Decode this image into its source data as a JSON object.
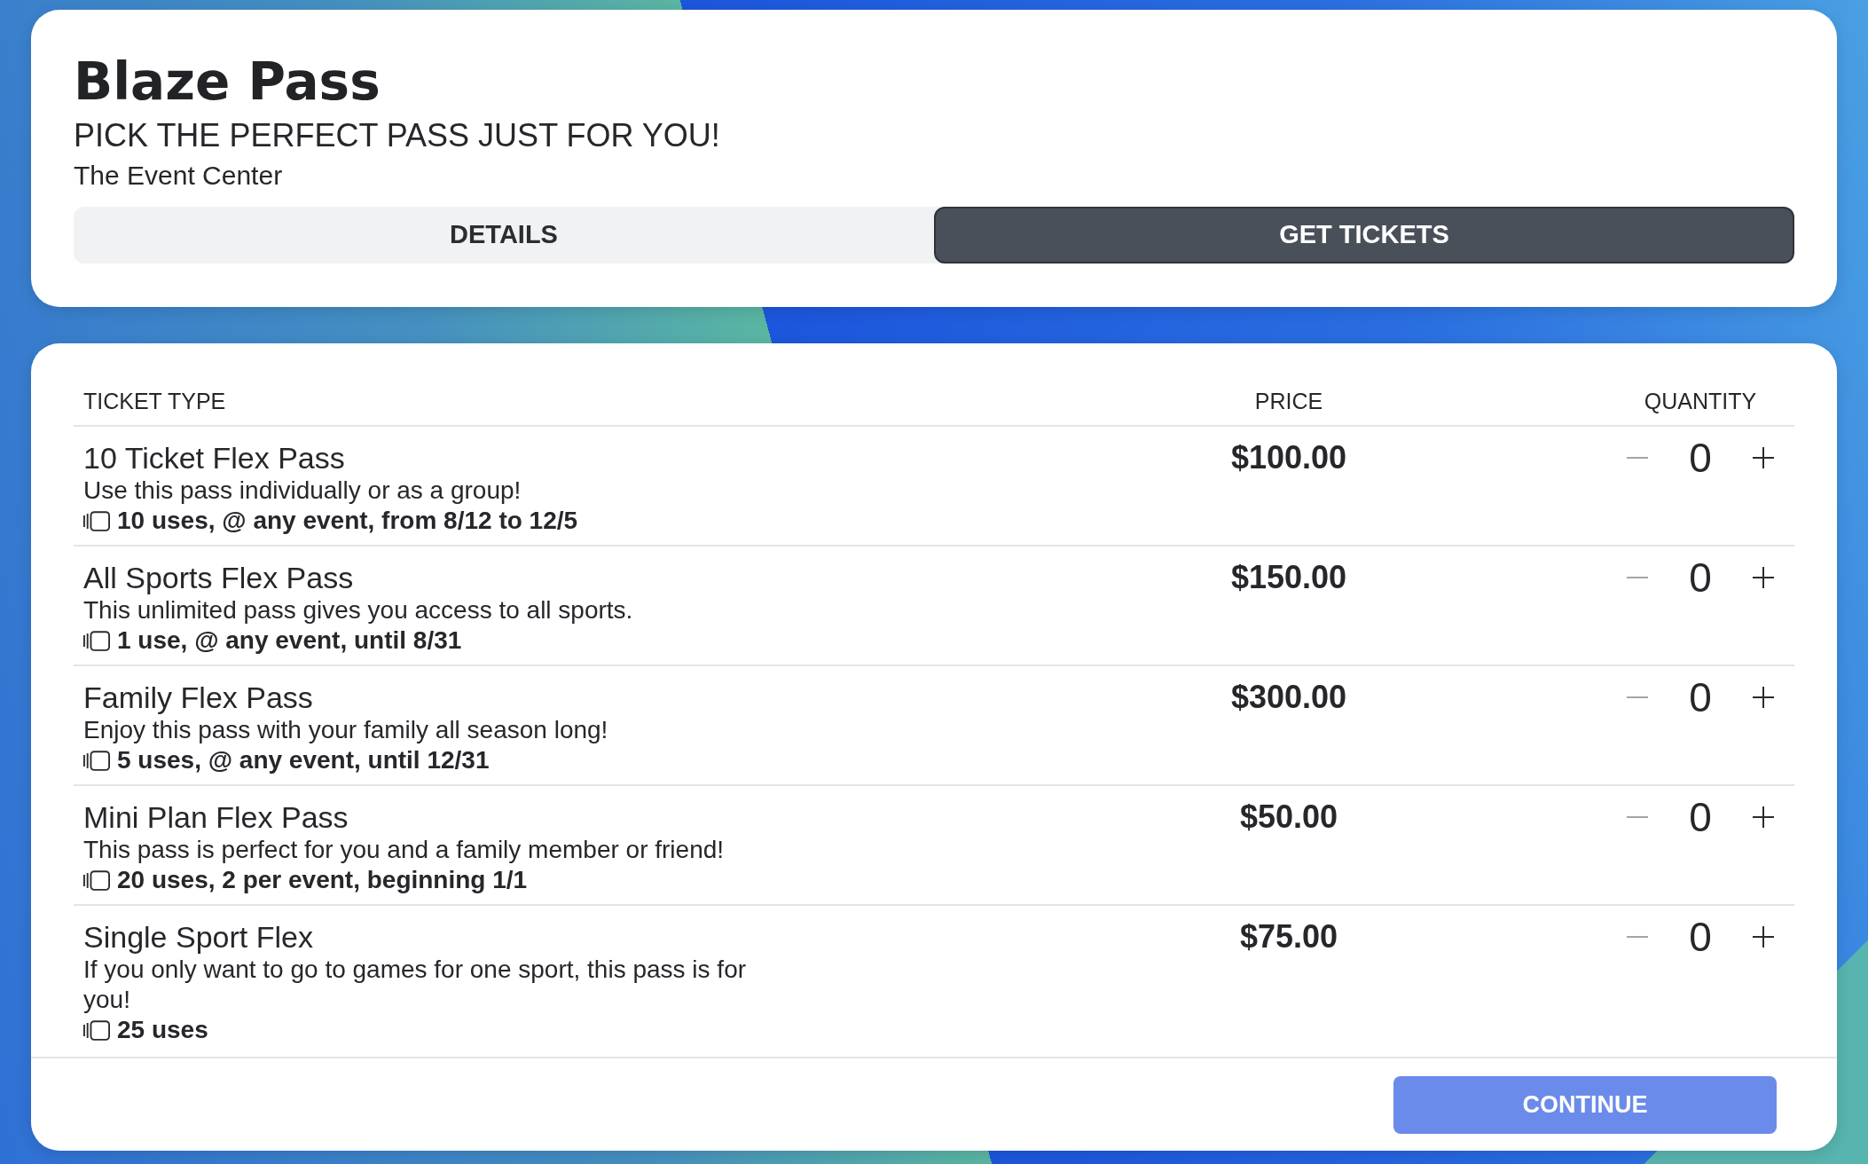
{
  "event": {
    "title": "Blaze Pass",
    "tagline": "PICK THE PERFECT PASS JUST FOR YOU!",
    "venue": "The Event Center"
  },
  "tabs": [
    {
      "label": "DETAILS",
      "selected": false
    },
    {
      "label": "GET TICKETS",
      "selected": true
    }
  ],
  "table": {
    "columns": [
      "TICKET TYPE",
      "PRICE",
      "QUANTITY"
    ],
    "rows": [
      {
        "name": "10 Ticket Flex Pass",
        "description": "Use this pass individually or as a group!",
        "uses": "10 uses, @ any event, from 8/12 to 12/5",
        "price": "$100.00",
        "quantity": "0",
        "decrease_disabled": true
      },
      {
        "name": "All Sports Flex Pass",
        "description": "This unlimited pass gives you access to all sports.",
        "uses": "1 use, @ any event, until 8/31",
        "price": "$150.00",
        "quantity": "0",
        "decrease_disabled": true
      },
      {
        "name": "Family Flex Pass",
        "description": "Enjoy this pass with your family all season long!",
        "uses": "5 uses, @ any event, until 12/31",
        "price": "$300.00",
        "quantity": "0",
        "decrease_disabled": true
      },
      {
        "name": "Mini Plan Flex Pass",
        "description": "This pass is perfect for you and a family member or friend!",
        "uses": "20 uses, 2 per event, beginning 1/1",
        "price": "$50.00",
        "quantity": "0",
        "decrease_disabled": true
      },
      {
        "name": "Single Sport Flex",
        "description": "If you only want to go to games for one sport, this pass is for you!",
        "uses": "25 uses",
        "price": "$75.00",
        "quantity": "0",
        "decrease_disabled": true
      }
    ]
  },
  "continue_button": {
    "label": "CONTINUE"
  }
}
